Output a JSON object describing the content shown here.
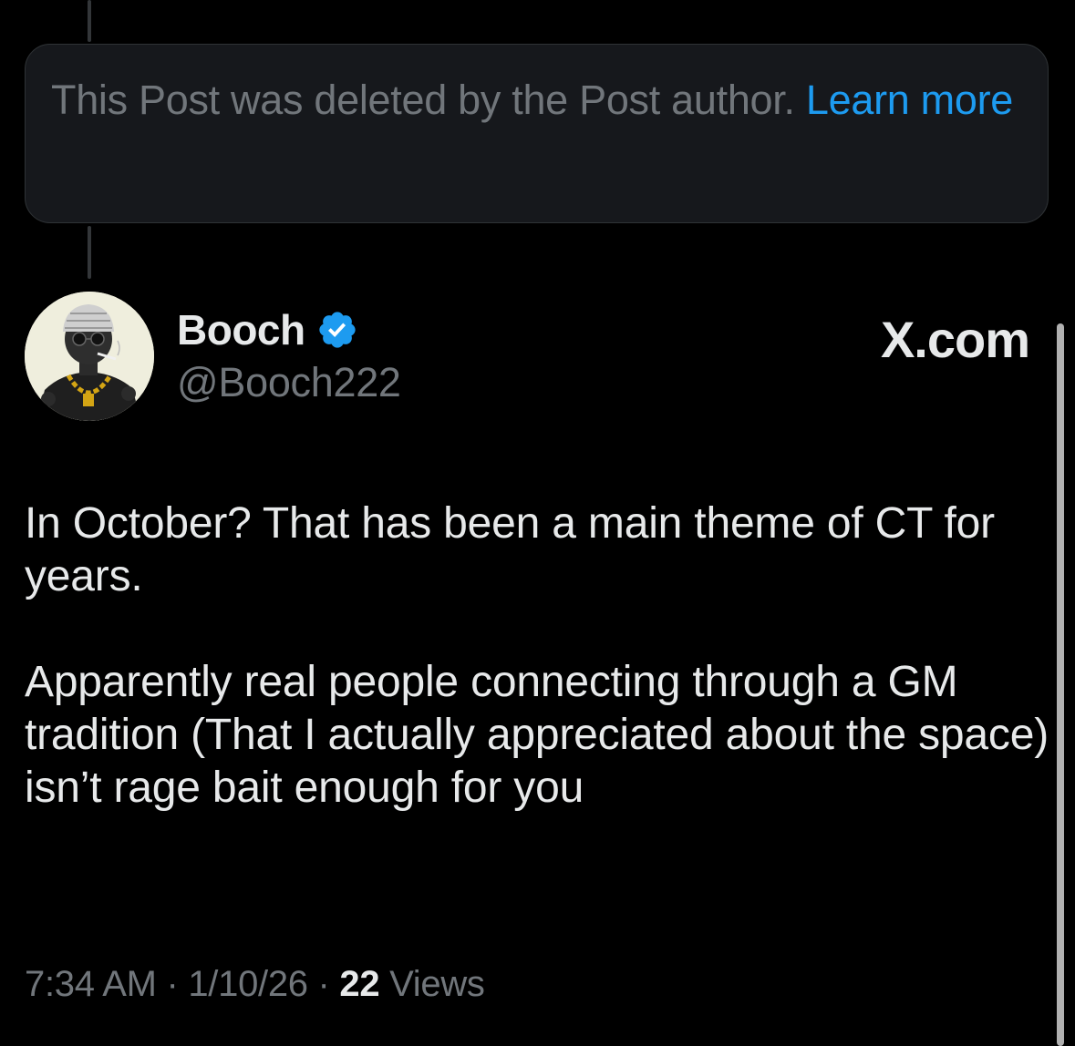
{
  "deleted_notice": {
    "text": "This Post was deleted by the Post author.",
    "link_label": "Learn more"
  },
  "post": {
    "author": {
      "display_name": "Booch",
      "handle": "@Booch222",
      "verified": true
    },
    "source_label": "X.com",
    "body_paragraphs": [
      "In October?  That has been a main theme of CT for years.",
      "Apparently real people connecting through a GM tradition (That I actually appreciated about the space) isn’t rage bait enough for you"
    ],
    "time": "7:34 AM",
    "date": "1/10/26",
    "views_count": "22",
    "views_label": "Views",
    "separator": "·"
  },
  "colors": {
    "background": "#000000",
    "primary_text": "#e7e9ea",
    "secondary_text": "#71767b",
    "link": "#1d9bf0",
    "verified_badge": "#1d9bf0"
  },
  "icons": {
    "verified": "verified-badge-icon",
    "avatar": "avatar-illustration"
  }
}
